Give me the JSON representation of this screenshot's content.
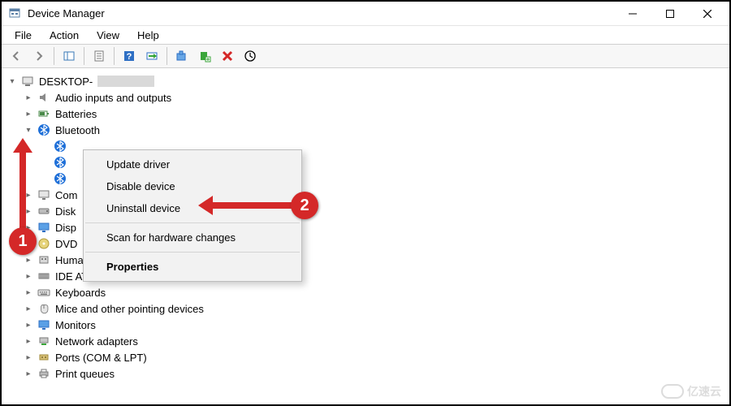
{
  "window": {
    "title": "Device Manager"
  },
  "menu": {
    "file": "File",
    "action": "Action",
    "view": "View",
    "help": "Help"
  },
  "toolbar_icons": {
    "back": "back-icon",
    "forward": "forward-icon",
    "up_tree": "show-hidden-icon",
    "properties": "properties-icon",
    "help": "help-icon",
    "scan": "scan-icon",
    "update": "update-driver-icon",
    "add_legacy": "add-hardware-icon",
    "uninstall": "uninstall-icon",
    "refresh": "refresh-icon"
  },
  "tree": {
    "root": "DESKTOP-",
    "audio": "Audio inputs and outputs",
    "batteries": "Batteries",
    "bluetooth": "Bluetooth",
    "bt_device_partial": "",
    "computer_partial": "Com",
    "disk_partial": "Disk",
    "display_partial": "Disp",
    "dvd_partial": "DVD",
    "hid_obscured": "Human Interface Devices",
    "ide": "IDE ATA/ATAPI controllers",
    "keyboards": "Keyboards",
    "mice": "Mice and other pointing devices",
    "monitors": "Monitors",
    "network": "Network adapters",
    "ports": "Ports (COM & LPT)",
    "print": "Print queues"
  },
  "context_menu": {
    "update": "Update driver",
    "disable": "Disable device",
    "uninstall": "Uninstall device",
    "scan": "Scan for hardware changes",
    "properties": "Properties"
  },
  "callouts": {
    "one": "1",
    "two": "2"
  },
  "watermark": "亿速云"
}
